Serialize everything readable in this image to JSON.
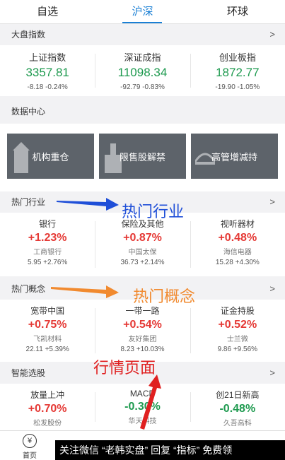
{
  "tabs": [
    "自选",
    "沪深",
    "环球"
  ],
  "sections": {
    "index": "大盘指数",
    "data_center": "数据中心",
    "hot_industry": "热门行业",
    "hot_concept": "热门概念",
    "smart_pick": "智能选股"
  },
  "indices": [
    {
      "name": "上证指数",
      "value": "3357.81",
      "change": "-8.18 -0.24%"
    },
    {
      "name": "深证成指",
      "value": "11098.34",
      "change": "-92.79 -0.83%"
    },
    {
      "name": "创业板指",
      "value": "1872.77",
      "change": "-19.90 -1.05%"
    }
  ],
  "data_cards": [
    "机构重仓",
    "限售股解禁",
    "高管增减持"
  ],
  "hot_industry": [
    {
      "name": "银行",
      "pct": "+1.23%",
      "stock": "工商银行",
      "sub": "5.95 +2.76%"
    },
    {
      "name": "保险及其他",
      "pct": "+0.87%",
      "stock": "中国太保",
      "sub": "36.73 +2.14%"
    },
    {
      "name": "视听器材",
      "pct": "+0.48%",
      "stock": "海信电器",
      "sub": "15.28 +4.30%"
    }
  ],
  "hot_concept": [
    {
      "name": "宽带中国",
      "pct": "+0.75%",
      "stock": "飞凯材料",
      "sub": "22.11 +5.39%"
    },
    {
      "name": "一带一路",
      "pct": "+0.54%",
      "stock": "友好集团",
      "sub": "8.23 +10.03%"
    },
    {
      "name": "证金持股",
      "pct": "+0.52%",
      "stock": "士兰微",
      "sub": "9.86 +9.56%"
    }
  ],
  "smart_pick": [
    {
      "name": "放量上冲",
      "pct": "+0.70%",
      "stock": "松发股份"
    },
    {
      "name": "MACD",
      "pct": "-0.30%",
      "stock": "华天科技"
    },
    {
      "name": "创21日新高",
      "pct": "-0.48%",
      "stock": "久吾高科"
    }
  ],
  "annotations": {
    "industry": "热门行业",
    "concept": "热门概念",
    "market": "行情页面"
  },
  "nav": {
    "home": "首页",
    "home_glyph": "¥"
  },
  "watermark": "关注微信 “老韩实盘” 回复 “指标” 免费领",
  "colors": {
    "up": "#e53935",
    "down": "#1e9a4f",
    "accent": "#1a7fd4"
  }
}
